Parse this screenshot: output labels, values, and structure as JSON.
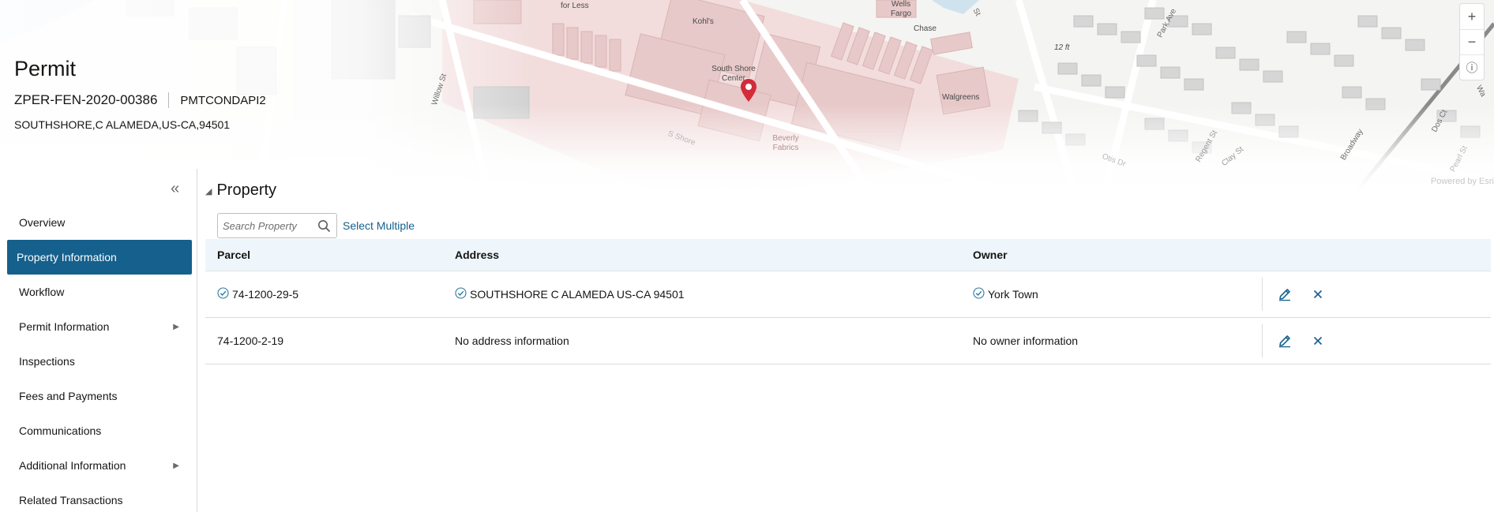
{
  "map": {
    "labels": {
      "for_less": "for Less",
      "kohls": "Kohl's",
      "wells_fargo": "Wells Fargo",
      "chase": "Chase",
      "south_shore_center": "South Shore Center",
      "walgreens": "Walgreens",
      "beverly_fabrics": "Beverly Fabrics",
      "twelve_ft": "12 ft"
    },
    "streets": {
      "willow": "Willow St",
      "park": "Park Ave",
      "broadway": "Broadway",
      "regent": "Regent St",
      "clay": "Clay St",
      "dos_ct": "Dos Ct",
      "walnut": "Wa",
      "st_top": "St",
      "s_shore": "S Shore",
      "otis": "Otis Dr",
      "pearl": "Pearl St"
    },
    "powered_by": "Powered by Esri",
    "zoom_in_symbol": "+",
    "zoom_out_symbol": "−",
    "info_symbol": "ⓘ",
    "pin_color": "#d42b3a"
  },
  "header": {
    "title": "Permit",
    "permit_number": "ZPER-FEN-2020-00386",
    "permit_type": "PMTCONDAPI2",
    "address": "SOUTHSHORE,C ALAMEDA,US-CA,94501"
  },
  "sidebar": {
    "collapse_symbol": "‹‹",
    "items": [
      {
        "label": "Overview"
      },
      {
        "label": "Property Information"
      },
      {
        "label": "Workflow"
      },
      {
        "label": "Permit Information"
      },
      {
        "label": "Inspections"
      },
      {
        "label": "Fees and Payments"
      },
      {
        "label": "Communications"
      },
      {
        "label": "Additional Information"
      },
      {
        "label": "Related Transactions"
      }
    ],
    "caret_symbol": "▶",
    "active_color": "#15608c"
  },
  "property": {
    "section_title": "Property",
    "toggle_symbol": "◢",
    "search_placeholder": "Search Property",
    "select_multiple": "Select Multiple",
    "columns": {
      "parcel": "Parcel",
      "address": "Address",
      "owner": "Owner"
    },
    "rows": [
      {
        "parcel": "74-1200-29-5",
        "address": "SOUTHSHORE C ALAMEDA US-CA 94501",
        "owner": "York Town"
      },
      {
        "parcel": "74-1200-2-19",
        "address": "No address information",
        "owner": "No owner information"
      }
    ],
    "edit_icon": "pencil-icon",
    "remove_icon": "close-icon",
    "accent_color": "#15608c",
    "header_bg": "#eef6fb"
  }
}
